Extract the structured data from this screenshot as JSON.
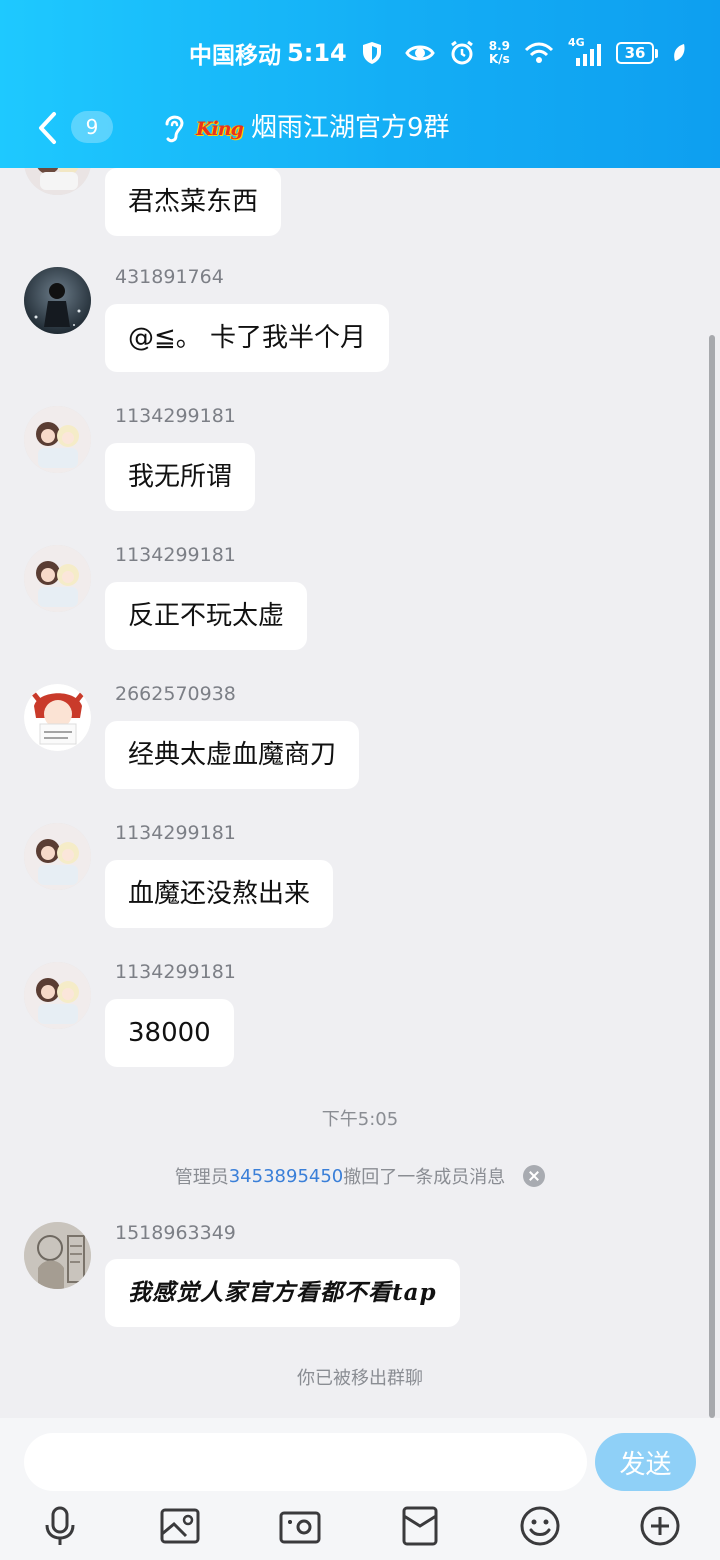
{
  "status_bar": {
    "carrier": "中国移动",
    "time": "5:14",
    "net_speed_value": "8.9",
    "net_speed_unit": "K/s",
    "network_type": "4G",
    "battery": "36"
  },
  "header": {
    "unread_count": "9",
    "title": "烟雨江湖官方9群",
    "badge_text": "King"
  },
  "messages": [
    {
      "sender": "",
      "text": "君杰菜东西"
    },
    {
      "sender": "431891764",
      "text": "@≦。 卡了我半个月"
    },
    {
      "sender": "1134299181",
      "text": "我无所谓"
    },
    {
      "sender": "1134299181",
      "text": "反正不玩太虚"
    },
    {
      "sender": "2662570938",
      "text": "经典太虚血魔商刀"
    },
    {
      "sender": "1134299181",
      "text": "血魔还没熬出来"
    },
    {
      "sender": "1134299181",
      "text": "38000"
    },
    {
      "sender": "1518963349",
      "text": "我感觉人家官方看都不看tap"
    }
  ],
  "timestamp": "下午5:05",
  "recall_notice": {
    "prefix": "管理员",
    "qq": "3453895450",
    "suffix": "撤回了一条成员消息"
  },
  "removed_notice": "你已被移出群聊",
  "input": {
    "placeholder": "",
    "send_label": "发送"
  },
  "toolbar": [
    "microphone-icon",
    "image-icon",
    "camera-icon",
    "red-packet-icon",
    "emoji-icon",
    "plus-icon"
  ]
}
